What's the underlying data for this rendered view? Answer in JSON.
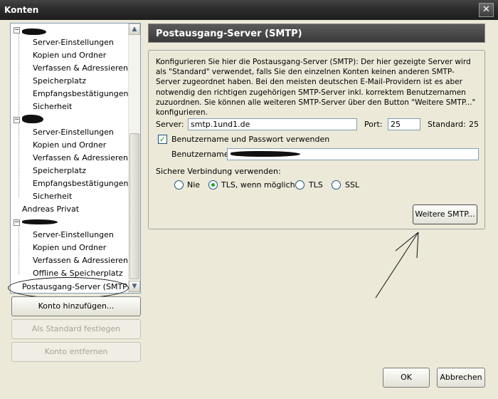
{
  "window": {
    "title": "Konten",
    "close_glyph": "✕"
  },
  "tree": {
    "accounts": [
      {
        "redacted": true,
        "items": [
          "Server-Einstellungen",
          "Kopien und Ordner",
          "Verfassen & Adressieren",
          "Speicherplatz",
          "Empfangsbestätigungen",
          "Sicherheit"
        ]
      },
      {
        "redacted": true,
        "items": [
          "Server-Einstellungen",
          "Kopien und Ordner",
          "Verfassen & Adressieren",
          "Speicherplatz",
          "Empfangsbestätigungen",
          "Sicherheit"
        ]
      },
      {
        "label": "Andreas Privat"
      },
      {
        "redacted": true,
        "items": [
          "Server-Einstellungen",
          "Kopien und Ordner",
          "Verfassen & Adressieren",
          "Offline & Speicherplatz"
        ]
      }
    ],
    "smtp_item": "Postausgang-Server (SMTP)",
    "toggle_glyph": "−"
  },
  "buttons": {
    "add_account": "Konto hinzufügen...",
    "set_default": "Als Standard festlegen",
    "remove_account": "Konto entfernen",
    "more_smtp": "Weitere SMTP...",
    "ok": "OK",
    "cancel": "Abbrechen"
  },
  "panel": {
    "title": "Postausgang-Server (SMTP)",
    "description": "Konfigurieren Sie hier die Postausgang-Server (SMTP): Der hier gezeigte Server wird als \"Standard\" verwendet, falls Sie den einzelnen Konten keinen anderen SMTP-Server zugeordnet haben. Bei den meisten deutschen E-Mail-Providern ist es aber notwendig den richtigen zugehörigen SMTP-Server inkl. korrektem Benutzernamen zuzuordnen. Sie können alle weiteren SMTP-Server über den Button \"Weitere SMTP...\" konfigurieren.",
    "server_label": "Server:",
    "server_value": "smtp.1und1.de",
    "port_label": "Port:",
    "port_value": "25",
    "standard_label": "Standard:",
    "standard_value": "25",
    "use_auth_label": "Benutzername und Passwort verwenden",
    "use_auth_checked": true,
    "username_label": "Benutzername:",
    "secure_label": "Sichere Verbindung verwenden:",
    "security_options": [
      "Nie",
      "TLS, wenn möglich",
      "TLS",
      "SSL"
    ],
    "security_selected": "TLS, wenn möglich"
  },
  "scrollbar": {
    "up_glyph": "▲",
    "down_glyph": "▼"
  },
  "check_glyph": "✓"
}
